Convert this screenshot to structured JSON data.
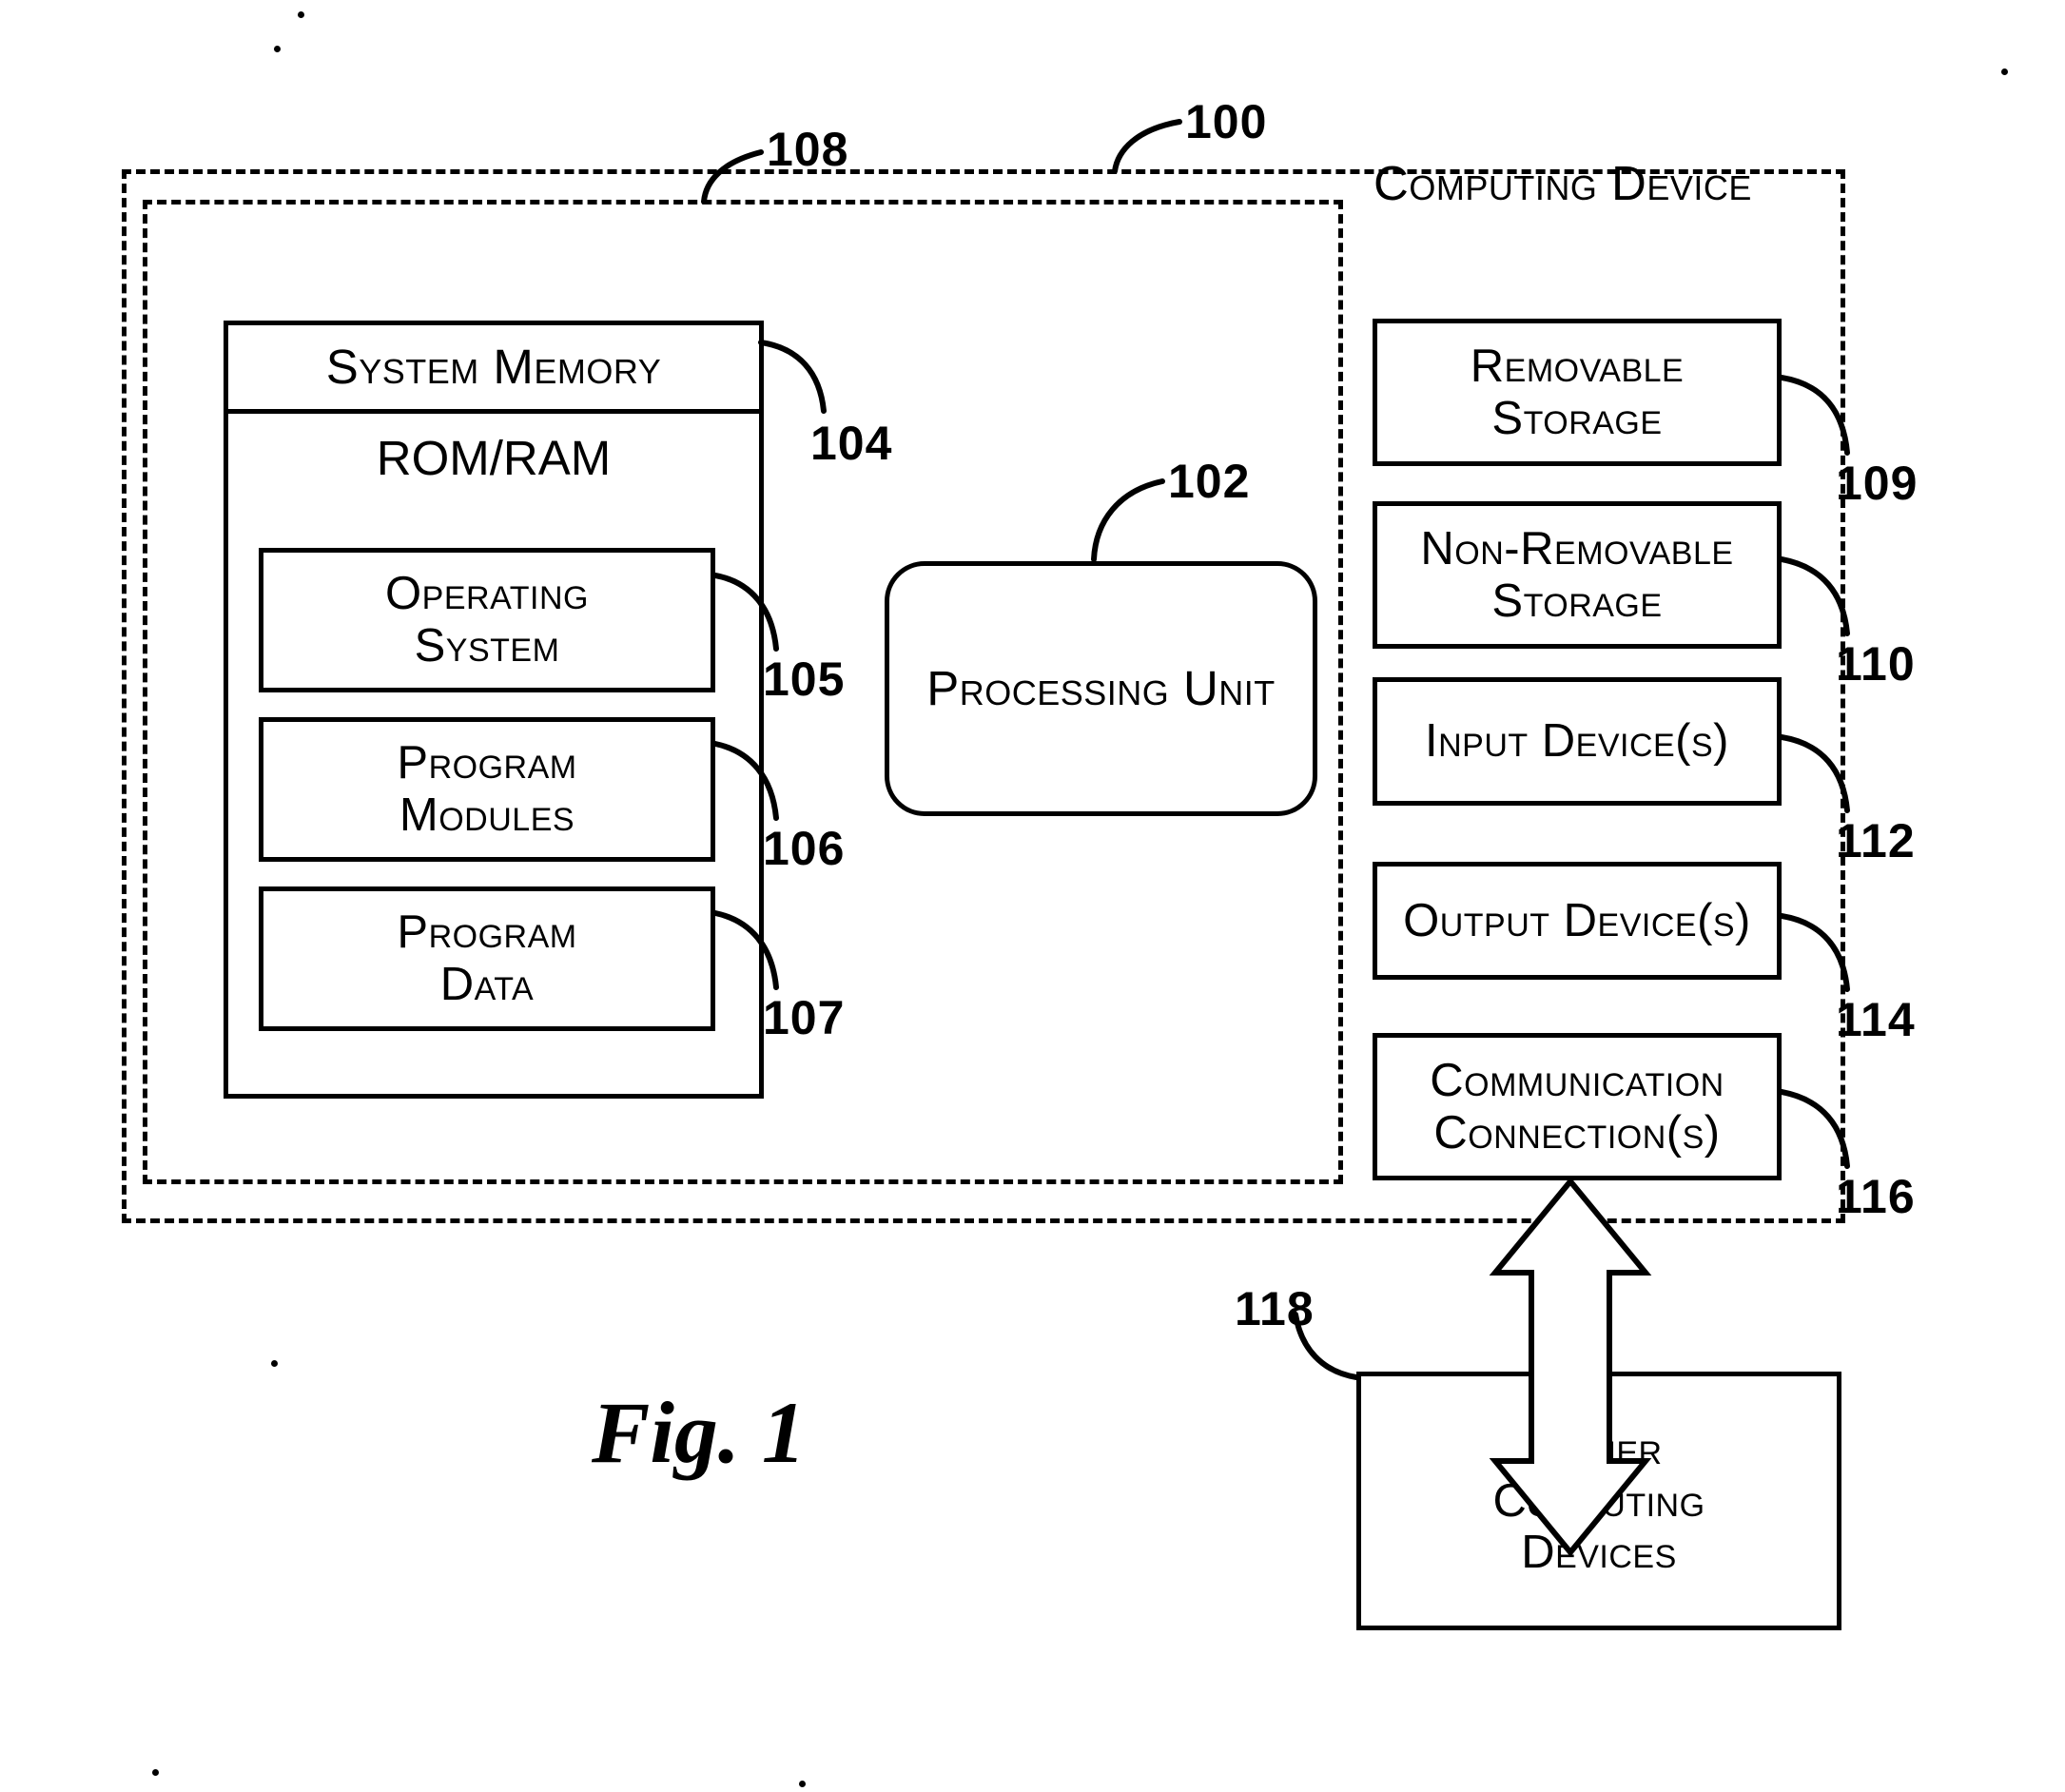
{
  "figure": {
    "caption": "Fig. 1",
    "title": "Computing Device"
  },
  "refs": {
    "device": "100",
    "processing_unit": "102",
    "system_memory": "104",
    "operating_system": "105",
    "program_modules": "106",
    "program_data": "107",
    "basic_configuration": "108",
    "removable_storage": "109",
    "non_removable_storage": "110",
    "input_devices": "112",
    "output_devices": "114",
    "communication_connections": "116",
    "other_computing_devices": "118"
  },
  "memory": {
    "header": "System Memory",
    "rom_ram": "ROM/RAM",
    "blocks": [
      {
        "line1": "Operating",
        "line2": "System"
      },
      {
        "line1": "Program",
        "line2": "Modules"
      },
      {
        "line1": "Program",
        "line2": "Data"
      }
    ]
  },
  "processing_unit": {
    "label": "Processing Unit"
  },
  "peripherals": [
    {
      "line1": "Removable",
      "line2": "Storage"
    },
    {
      "line1": "Non-Removable",
      "line2": "Storage"
    },
    {
      "line1": "Input Device(s)",
      "line2": ""
    },
    {
      "line1": "Output Device(s)",
      "line2": ""
    },
    {
      "line1": "Communication",
      "line2": "Connection(s)"
    }
  ],
  "external": {
    "line1": "Other",
    "line2": "Computing",
    "line3": "Devices"
  },
  "colors": {
    "ink": "#000000",
    "paper": "#ffffff"
  }
}
